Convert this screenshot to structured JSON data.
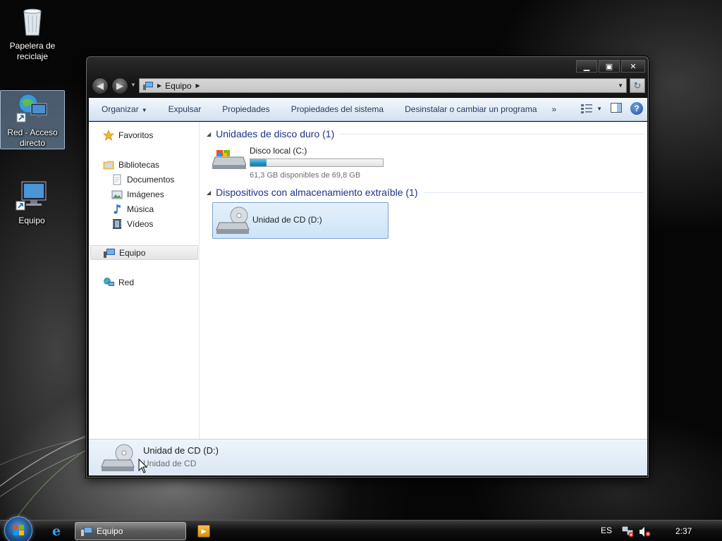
{
  "desktop": {
    "icons": [
      {
        "label": "Papelera de reciclaje",
        "icon": "recycle-bin-icon"
      },
      {
        "label": "Red - Acceso directo",
        "icon": "network-shortcut-icon",
        "selected": true
      },
      {
        "label": "Equipo",
        "icon": "computer-icon"
      }
    ]
  },
  "window": {
    "address": {
      "segments": [
        "Equipo"
      ]
    },
    "toolbar": {
      "organize": "Organizar",
      "eject": "Expulsar",
      "properties": "Propiedades",
      "system_properties": "Propiedades del sistema",
      "uninstall": "Desinstalar o cambiar un programa",
      "more": "»"
    },
    "nav": {
      "favorites": "Favoritos",
      "libraries": "Bibliotecas",
      "documents": "Documentos",
      "images": "Imágenes",
      "music": "Música",
      "videos": "Vídeos",
      "computer": "Equipo",
      "network": "Red"
    },
    "groups": {
      "hard_disks": "Unidades de disco duro (1)",
      "removable": "Dispositivos con almacenamiento extraíble (1)"
    },
    "drives": {
      "local": {
        "name": "Disco local (C:)",
        "free_text": "61,3 GB disponibles de 69,8 GB",
        "used_fraction": 0.122
      },
      "cd": {
        "name": "Unidad de CD (D:)"
      }
    },
    "details": {
      "title": "Unidad de CD (D:)",
      "subtitle": "Unidad de CD"
    }
  },
  "taskbar": {
    "task_label": "Equipo",
    "language": "ES",
    "clock": "2:37"
  },
  "colors": {
    "accent": "#1e3287",
    "selection": "#cde3f8",
    "bar_fill": "#1c8fc4"
  }
}
